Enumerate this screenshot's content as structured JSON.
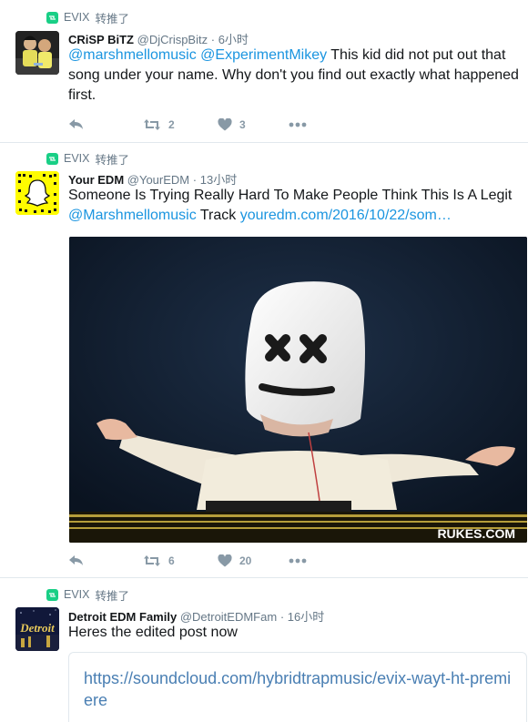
{
  "tweets": [
    {
      "retweeter": "EVIX",
      "retweet_label": "转推了",
      "author_name": "CRiSP BiTZ",
      "handle": "@DjCrispBitz",
      "time": "6小时",
      "text_mentions": [
        "@marshmellomusic",
        "@ExperimentMikey"
      ],
      "text": "This kid did not put out that song under your name. Why don't you find out exactly what happened first.",
      "retweets": "2",
      "likes": "3"
    },
    {
      "retweeter": "EVIX",
      "retweet_label": "转推了",
      "author_name": "Your EDM",
      "handle": "@YourEDM",
      "time": "13小时",
      "text_before": "Someone Is Trying Really Hard To Make People Think This Is A Legit",
      "mention": "@Marshmellomusic",
      "text_mid": "Track",
      "link": "youredm.com/2016/10/22/som…",
      "media_watermark": "RUKES.COM",
      "retweets": "6",
      "likes": "20"
    },
    {
      "retweeter": "EVIX",
      "retweet_label": "转推了",
      "author_name": "Detroit EDM Family",
      "handle": "@DetroitEDMFam",
      "time": "16小时",
      "text": "Heres the edited post now",
      "card_url": "https://soundcloud.com/hybridtrapmusic/evix-wayt-ht-premiere",
      "avatar_logo_text": "Detroit"
    }
  ],
  "separator": "·",
  "colors": {
    "link": "#1b95e0",
    "retweet_badge": "#19cf86",
    "meta": "#657786",
    "action": "#8899a6"
  },
  "icons": [
    "reply-icon",
    "retweet-icon",
    "heart-icon",
    "more-icon",
    "retweet-badge-icon"
  ]
}
